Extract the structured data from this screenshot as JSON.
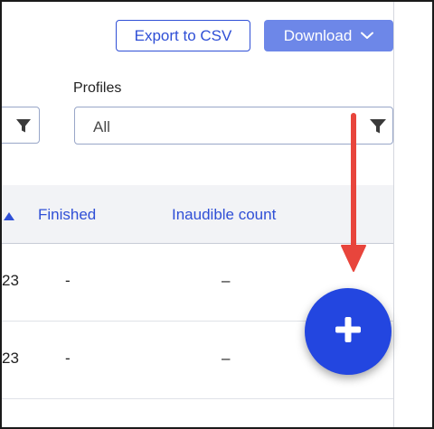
{
  "toolbar": {
    "export_label": "Export to CSV",
    "download_label": "Download"
  },
  "filters": {
    "profiles_label": "Profiles",
    "profiles_value": "All"
  },
  "table": {
    "columns": {
      "finished": "Finished",
      "inaudible_count": "Inaudible count"
    },
    "rows": [
      {
        "date": "23",
        "finished": "-",
        "inaudible": "–"
      },
      {
        "date": "23",
        "finished": "-",
        "inaudible": "–"
      }
    ]
  },
  "colors": {
    "accent": "#2f4fd6",
    "download_button": "#6d87e8",
    "fab": "#2346e0",
    "annotation_arrow": "#e8453c",
    "header_bg": "#f2f3f6"
  },
  "icons": {
    "filter": "filter-funnel-icon",
    "download_caret": "chevron-down-icon",
    "sort": "sort-ascending-icon",
    "fab": "plus-icon",
    "annotation": "red-arrow-icon"
  }
}
